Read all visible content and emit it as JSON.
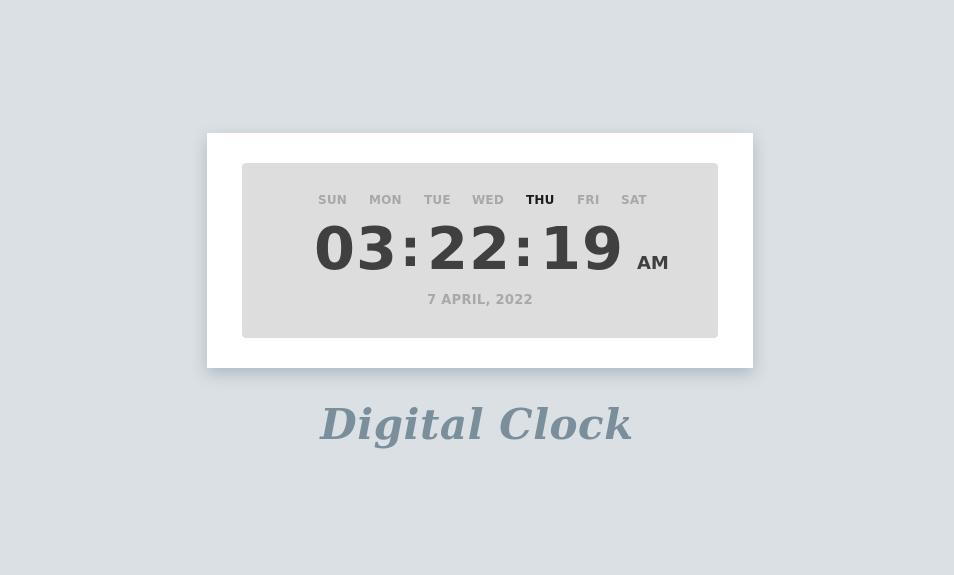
{
  "clock": {
    "days": [
      "SUN",
      "MON",
      "TUE",
      "WED",
      "THU",
      "FRI",
      "SAT"
    ],
    "active_day": "THU",
    "hours": "03",
    "minutes": "22",
    "seconds": "19",
    "separator": ":",
    "period": "AM",
    "date": "7 APRIL, 2022"
  },
  "footer": {
    "title": "Digital Clock"
  },
  "colors": {
    "background": "#dae0e4",
    "card": "#ffffff",
    "panel": "#dddddd",
    "digits": "#404040",
    "inactive_day": "#a8a8a8",
    "active_day": "#1a1a1a",
    "title": "#7b8e9c"
  }
}
